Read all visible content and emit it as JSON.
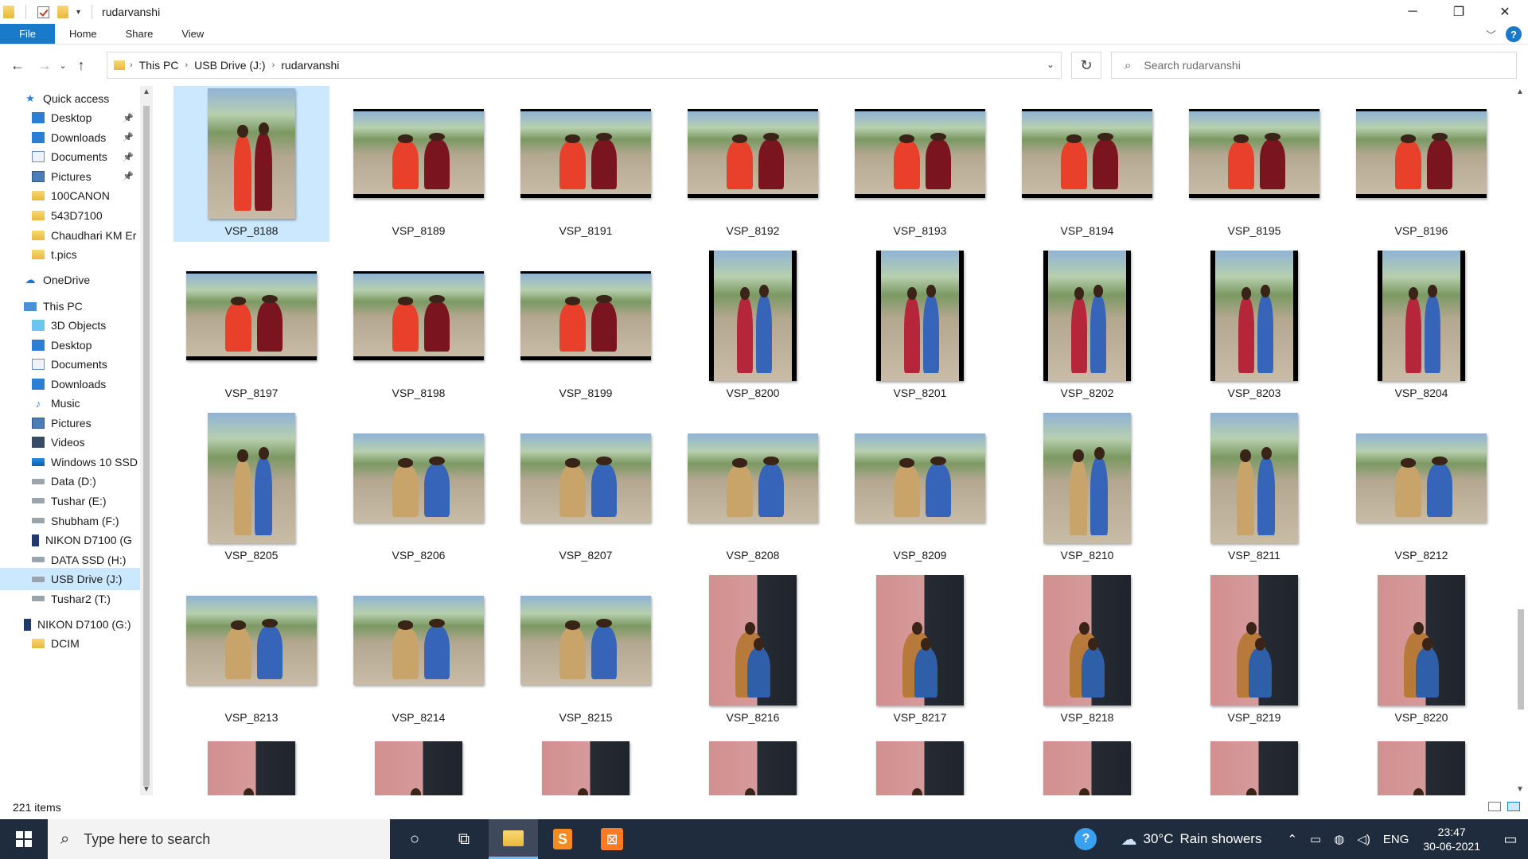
{
  "window": {
    "title": "rudarvanshi",
    "minimize": "─",
    "maximize": "❐",
    "close": "✕"
  },
  "ribbon": {
    "tabs": [
      "File",
      "Home",
      "Share",
      "View"
    ]
  },
  "address": {
    "crumbs": [
      "This PC",
      "USB Drive (J:)",
      "rudarvanshi"
    ],
    "search_placeholder": "Search rudarvanshi"
  },
  "nav": {
    "quick_access": "Quick access",
    "quick_items": [
      {
        "label": "Desktop",
        "icon": "desktop-icon",
        "pinned": true
      },
      {
        "label": "Downloads",
        "icon": "download-icon",
        "pinned": true
      },
      {
        "label": "Documents",
        "icon": "document-icon",
        "pinned": true
      },
      {
        "label": "Pictures",
        "icon": "pictures-icon",
        "pinned": true
      },
      {
        "label": "100CANON",
        "icon": "folder-icon",
        "pinned": false
      },
      {
        "label": "543D7100",
        "icon": "folder-icon",
        "pinned": false
      },
      {
        "label": "Chaudhari KM Er",
        "icon": "folder-icon",
        "pinned": false
      },
      {
        "label": "t.pics",
        "icon": "folder-icon",
        "pinned": false
      }
    ],
    "onedrive": "OneDrive",
    "this_pc": "This PC",
    "pc_items": [
      {
        "label": "3D Objects",
        "icon": "cube-icon"
      },
      {
        "label": "Desktop",
        "icon": "desktop-icon"
      },
      {
        "label": "Documents",
        "icon": "document-icon"
      },
      {
        "label": "Downloads",
        "icon": "download-icon"
      },
      {
        "label": "Music",
        "icon": "music-icon"
      },
      {
        "label": "Pictures",
        "icon": "pictures-icon"
      },
      {
        "label": "Videos",
        "icon": "videos-icon"
      },
      {
        "label": "Windows 10 SSD",
        "icon": "windows-drive-icon"
      },
      {
        "label": "Data (D:)",
        "icon": "drive-icon"
      },
      {
        "label": "Tushar (E:)",
        "icon": "drive-icon"
      },
      {
        "label": "Shubham (F:)",
        "icon": "drive-icon"
      },
      {
        "label": "NIKON D7100 (G",
        "icon": "camera-device-icon"
      },
      {
        "label": "DATA SSD (H:)",
        "icon": "drive-icon"
      },
      {
        "label": "USB Drive (J:)",
        "icon": "drive-icon",
        "selected": true
      },
      {
        "label": "Tushar2 (T:)",
        "icon": "drive-icon"
      }
    ],
    "nikon": "NIKON D7100 (G:)",
    "dcim": "DCIM"
  },
  "files": [
    {
      "name": "VSP_8188",
      "orient": "port",
      "scene": "outdoor",
      "frame": false,
      "selected": true
    },
    {
      "name": "VSP_8189",
      "orient": "land",
      "scene": "outdoor",
      "frame": true
    },
    {
      "name": "VSP_8191",
      "orient": "land",
      "scene": "outdoor",
      "frame": true
    },
    {
      "name": "VSP_8192",
      "orient": "land",
      "scene": "outdoor",
      "frame": true
    },
    {
      "name": "VSP_8193",
      "orient": "land",
      "scene": "outdoor",
      "frame": true
    },
    {
      "name": "VSP_8194",
      "orient": "land",
      "scene": "outdoor",
      "frame": true
    },
    {
      "name": "VSP_8195",
      "orient": "land",
      "scene": "outdoor",
      "frame": true
    },
    {
      "name": "VSP_8196",
      "orient": "land",
      "scene": "outdoor",
      "frame": true
    },
    {
      "name": "VSP_8197",
      "orient": "land",
      "scene": "outdoor",
      "frame": true
    },
    {
      "name": "VSP_8198",
      "orient": "land",
      "scene": "outdoor",
      "frame": true
    },
    {
      "name": "VSP_8199",
      "orient": "land",
      "scene": "outdoor",
      "frame": true
    },
    {
      "name": "VSP_8200",
      "orient": "port",
      "scene": "outdoor",
      "frame": true
    },
    {
      "name": "VSP_8201",
      "orient": "port",
      "scene": "outdoor",
      "frame": true
    },
    {
      "name": "VSP_8202",
      "orient": "port",
      "scene": "outdoor",
      "frame": true
    },
    {
      "name": "VSP_8203",
      "orient": "port",
      "scene": "outdoor",
      "frame": true
    },
    {
      "name": "VSP_8204",
      "orient": "port",
      "scene": "outdoor",
      "frame": true
    },
    {
      "name": "VSP_8205",
      "orient": "port",
      "scene": "outdoor",
      "frame": false
    },
    {
      "name": "VSP_8206",
      "orient": "land",
      "scene": "outdoor",
      "frame": false
    },
    {
      "name": "VSP_8207",
      "orient": "land",
      "scene": "outdoor",
      "frame": false
    },
    {
      "name": "VSP_8208",
      "orient": "land",
      "scene": "outdoor",
      "frame": false
    },
    {
      "name": "VSP_8209",
      "orient": "land",
      "scene": "outdoor",
      "frame": false
    },
    {
      "name": "VSP_8210",
      "orient": "port",
      "scene": "outdoor",
      "frame": false
    },
    {
      "name": "VSP_8211",
      "orient": "port",
      "scene": "outdoor",
      "frame": false
    },
    {
      "name": "VSP_8212",
      "orient": "land",
      "scene": "outdoor",
      "frame": false
    },
    {
      "name": "VSP_8213",
      "orient": "land",
      "scene": "outdoor",
      "frame": false
    },
    {
      "name": "VSP_8214",
      "orient": "land",
      "scene": "outdoor",
      "frame": false
    },
    {
      "name": "VSP_8215",
      "orient": "land",
      "scene": "outdoor",
      "frame": false
    },
    {
      "name": "VSP_8216",
      "orient": "port",
      "scene": "indoor",
      "frame": false
    },
    {
      "name": "VSP_8217",
      "orient": "port",
      "scene": "indoor",
      "frame": false
    },
    {
      "name": "VSP_8218",
      "orient": "port",
      "scene": "indoor",
      "frame": false
    },
    {
      "name": "VSP_8219",
      "orient": "port",
      "scene": "indoor",
      "frame": false
    },
    {
      "name": "VSP_8220",
      "orient": "port",
      "scene": "indoor",
      "frame": false
    },
    {
      "name": "",
      "orient": "port",
      "scene": "indoor",
      "frame": false
    },
    {
      "name": "",
      "orient": "port",
      "scene": "indoor",
      "frame": false
    },
    {
      "name": "",
      "orient": "port",
      "scene": "indoor",
      "frame": false
    },
    {
      "name": "",
      "orient": "port",
      "scene": "indoor",
      "frame": false
    },
    {
      "name": "",
      "orient": "port",
      "scene": "indoor",
      "frame": false
    },
    {
      "name": "",
      "orient": "port",
      "scene": "indoor",
      "frame": false
    },
    {
      "name": "",
      "orient": "port",
      "scene": "indoor",
      "frame": false
    },
    {
      "name": "",
      "orient": "port",
      "scene": "indoor",
      "frame": false
    }
  ],
  "status": {
    "count": "221 items"
  },
  "taskbar": {
    "search_placeholder": "Type here to search",
    "temperature": "30°C",
    "weather": "Rain showers",
    "language": "ENG",
    "time": "23:47",
    "date": "30-06-2021"
  },
  "colors": {
    "accent": "#1979ca",
    "selection": "#cce8ff",
    "taskbar": "#1f2c3d"
  }
}
